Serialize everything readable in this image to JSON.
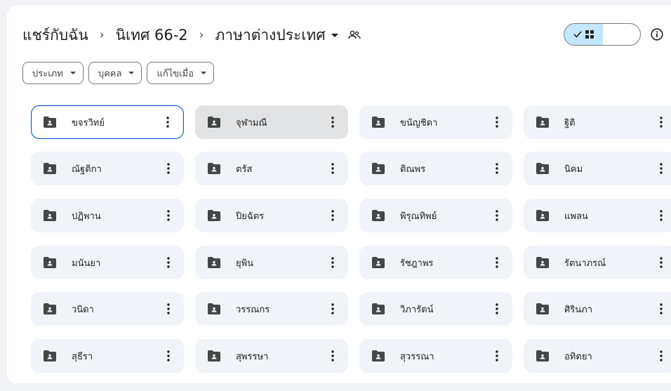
{
  "breadcrumb": {
    "items": [
      "แชร์กับฉัน",
      "นิเทศ 66-2",
      "ภาษาต่างประเทศ"
    ],
    "separator": "›"
  },
  "icons": {
    "folder": "shared-folder-icon",
    "more": "more-vert-icon",
    "list_view": "list-icon",
    "grid_view": "grid-icon",
    "check": "check-icon",
    "info": "info-icon",
    "shared": "people-icon"
  },
  "colors": {
    "accent": "#0b57d0",
    "toggle_active": "#c2e7ff",
    "card_bg": "#f0f4f9",
    "card_hover": "#e1e3e5",
    "folder": "#444746"
  },
  "filters": [
    "ประเภท",
    "บุคคล",
    "แก้ไขเมื่อ"
  ],
  "folders": [
    "ขจรวิทย์",
    "จุฬามณี",
    "ขนัญชิดา",
    "ฐิติ",
    "ณัฐติกา",
    "ตรัส",
    "ติณพร",
    "นิคม",
    "ปฏิพาน",
    "ปิยฉัตร",
    "พิรุณทิพย์",
    "แพลน",
    "มนันยา",
    "ยุพิน",
    "รัชฎาพร",
    "รัตนาภรณ์",
    "วนิดา",
    "วรรณกร",
    "วิภารัตน์",
    "ศิรินภา",
    "สุธีรา",
    "สุพรรษา",
    "สุวรรณา",
    "อทิตยา"
  ],
  "selected_index": 0,
  "hover_index": 1
}
